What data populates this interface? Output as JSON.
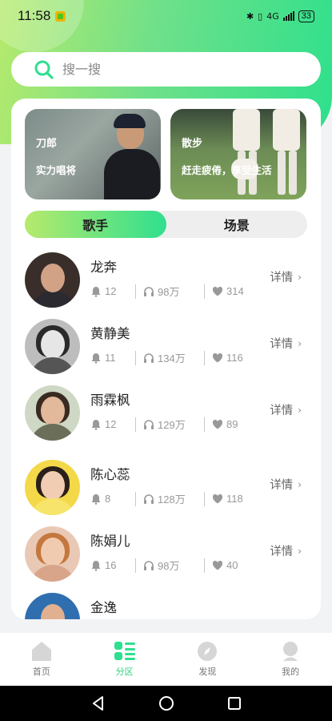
{
  "status_bar": {
    "time": "11:58",
    "battery": "33",
    "network": "4G"
  },
  "search": {
    "placeholder": "搜一搜"
  },
  "banners": [
    {
      "title": "刀郎",
      "subtitle": "实力唱将"
    },
    {
      "title": "散步",
      "subtitle": "赶走疲倦，享受生活"
    }
  ],
  "tabs": [
    {
      "label": "歌手",
      "active": true
    },
    {
      "label": "场景",
      "active": false
    }
  ],
  "singers": [
    {
      "name": "龙奔",
      "likes": "12",
      "plays": "98万",
      "favorites": "314",
      "detail": "详情"
    },
    {
      "name": "黄静美",
      "likes": "11",
      "plays": "134万",
      "favorites": "116",
      "detail": "详情"
    },
    {
      "name": "雨霖枫",
      "likes": "12",
      "plays": "129万",
      "favorites": "89",
      "detail": "详情"
    },
    {
      "name": "陈心蕊",
      "likes": "8",
      "plays": "128万",
      "favorites": "118",
      "detail": "详情"
    },
    {
      "name": "陈娟儿",
      "likes": "16",
      "plays": "98万",
      "favorites": "40",
      "detail": "详情"
    },
    {
      "name": "金逸",
      "likes": "",
      "plays": "",
      "favorites": "",
      "detail": ""
    }
  ],
  "bottom_nav": [
    {
      "label": "首页",
      "icon": "home-icon",
      "active": false
    },
    {
      "label": "分区",
      "icon": "category-icon",
      "active": true
    },
    {
      "label": "发现",
      "icon": "compass-icon",
      "active": false
    },
    {
      "label": "我的",
      "icon": "profile-icon",
      "active": false
    }
  ],
  "colors": {
    "accent": "#2fdf8f",
    "accent_light": "#b6ea6c"
  }
}
